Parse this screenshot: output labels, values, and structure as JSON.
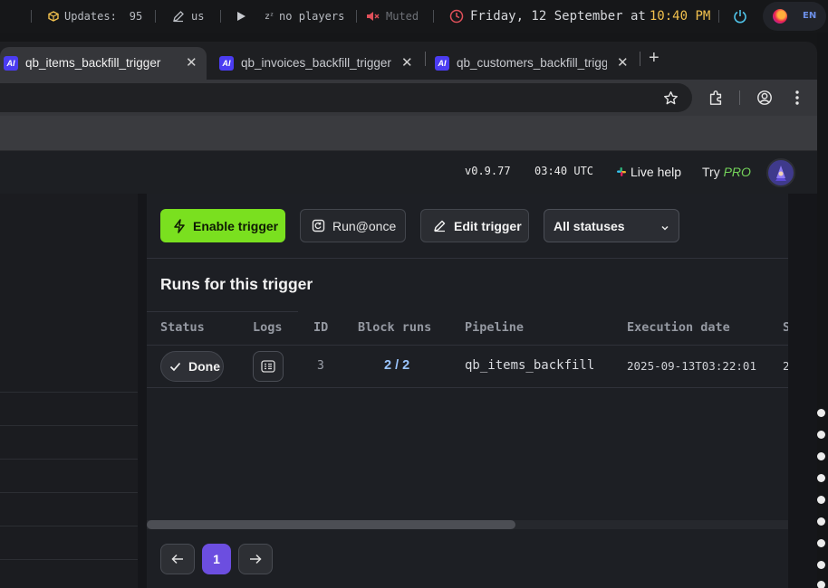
{
  "system_bar": {
    "updates_label": "Updates:",
    "updates_count": "95",
    "keyboard_layout": "us",
    "players_text": "no players",
    "volume_text": "Muted",
    "date_text": "Friday, 12 September at ",
    "time_text": "10:40 PM",
    "language": "EN"
  },
  "browser": {
    "tabs": [
      {
        "favicon": "AI",
        "title": "qb_items_backfill_trigger"
      },
      {
        "favicon": "AI",
        "title": "qb_invoices_backfill_trigger"
      },
      {
        "favicon": "AI",
        "title": "qb_customers_backfill_trigger"
      }
    ],
    "toolbar_icons": [
      "bookmark-star-icon",
      "extensions-icon",
      "profile-icon",
      "more-menu-icon"
    ]
  },
  "app_header": {
    "version": "v0.9.77",
    "time_utc": "03:40 UTC",
    "live_help": "Live help",
    "try_label": "Try",
    "pro_label": "PRO"
  },
  "actions": {
    "enable_trigger": "Enable trigger",
    "run_once": "Run@once",
    "edit_trigger": "Edit trigger",
    "status_filter": "All statuses"
  },
  "runs": {
    "title": "Runs for this trigger",
    "columns": [
      "Status",
      "Logs",
      "ID",
      "Block runs",
      "Pipeline",
      "Execution date",
      "S"
    ],
    "rows": [
      {
        "status": "Done",
        "id": "3",
        "block_runs": "2 / 2",
        "pipeline": "qb_items_backfill",
        "execution_date": "2025-09-13T03:22:01",
        "extra": "2"
      }
    ]
  },
  "pagination": {
    "current_page": "1"
  },
  "colors": {
    "accent_green": "#7ae01f",
    "page_active": "#6c4ee0",
    "clock_highlight": "#f2c14e",
    "pro_green": "#74d35a"
  }
}
